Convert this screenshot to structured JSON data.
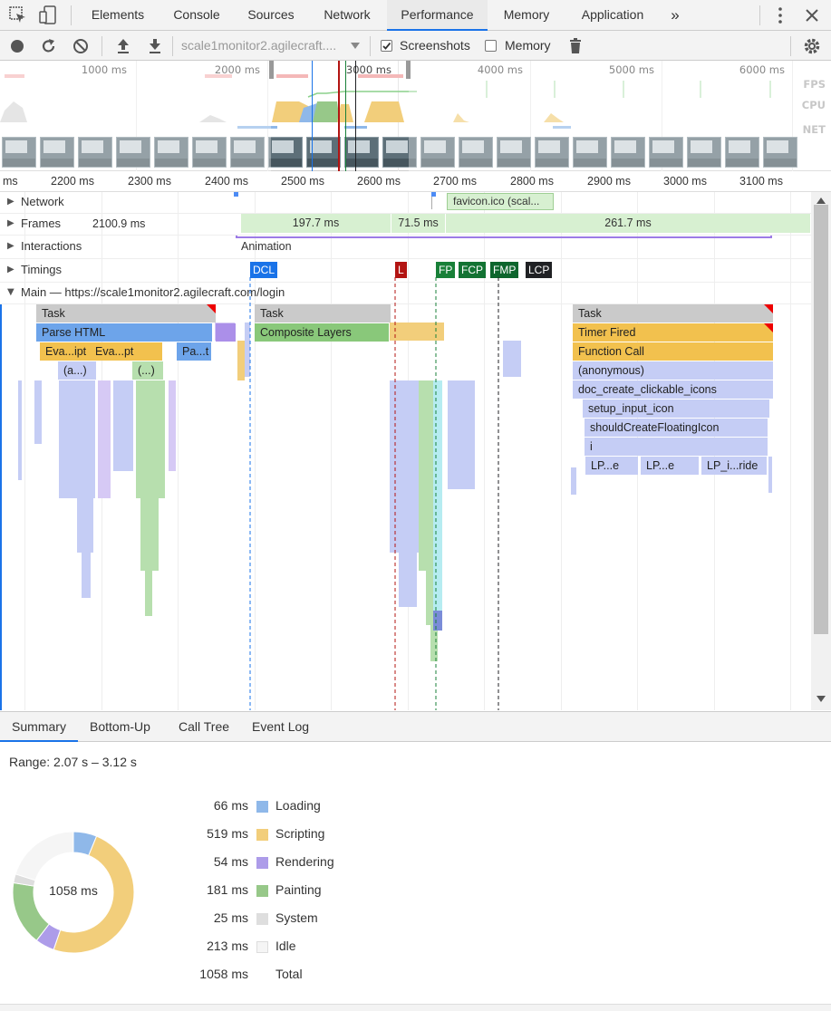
{
  "tabs": {
    "elements": "Elements",
    "console": "Console",
    "sources": "Sources",
    "network": "Network",
    "performance": "Performance",
    "memory": "Memory",
    "application": "Application",
    "more": "»"
  },
  "toolbar": {
    "profile_select": "scale1monitor2.agilecraft....",
    "screenshots_label": "Screenshots",
    "screenshots_checked": true,
    "memory_label": "Memory",
    "memory_checked": false
  },
  "overview": {
    "ticks": [
      "1000 ms",
      "2000 ms",
      "3000 ms",
      "4000 ms",
      "5000 ms",
      "6000 ms"
    ],
    "fps_label": "FPS",
    "cpu_label": "CPU",
    "net_label": "NET"
  },
  "ruler": {
    "labels": [
      "ms",
      "2200 ms",
      "2300 ms",
      "2400 ms",
      "2500 ms",
      "2600 ms",
      "2700 ms",
      "2800 ms",
      "2900 ms",
      "3000 ms",
      "3100 ms"
    ]
  },
  "tracks": {
    "network": "Network",
    "network_item": "favicon.ico (scal...",
    "frames": "Frames",
    "frame_values": [
      "2100.9 ms",
      "197.7 ms",
      "71.5 ms",
      "261.7 ms"
    ],
    "interactions": "Interactions",
    "interaction_item": "Animation",
    "timings": "Timings",
    "timing_markers": [
      "DCL",
      "L",
      "FP",
      "FCP",
      "FMP",
      "LCP"
    ],
    "main": "Main — https://scale1monitor2.agilecraft.com/login"
  },
  "flame": {
    "task": "Task",
    "parse_html": "Parse HTML",
    "eval1": "Eva...ipt",
    "eval2": "Eva...pt",
    "paint": "Pa...t",
    "anon_a": "(a...)",
    "anon_b": "(...)",
    "composite": "Composite Layers",
    "timer_fired": "Timer Fired",
    "function_call": "Function Call",
    "anonymous": "(anonymous)",
    "doc_create": "doc_create_clickable_icons",
    "setup_input": "setup_input_icon",
    "should_create": "shouldCreateFloatingIcon",
    "i": "i",
    "lp1": "LP...e",
    "lp2": "LP...e",
    "lp3": "LP_i...ride"
  },
  "bottom_tabs": {
    "summary": "Summary",
    "bottom_up": "Bottom-Up",
    "call_tree": "Call Tree",
    "event_log": "Event Log"
  },
  "summary": {
    "range": "Range: 2.07 s – 3.12 s",
    "total_center": "1058 ms",
    "rows": [
      {
        "value": "66 ms",
        "name": "Loading",
        "color": "#8fb8e9"
      },
      {
        "value": "519 ms",
        "name": "Scripting",
        "color": "#f2ce7b"
      },
      {
        "value": "54 ms",
        "name": "Rendering",
        "color": "#ad9ce9"
      },
      {
        "value": "181 ms",
        "name": "Painting",
        "color": "#97c889"
      },
      {
        "value": "25 ms",
        "name": "System",
        "color": "#dedede"
      },
      {
        "value": "213 ms",
        "name": "Idle",
        "color": "#f5f5f5"
      },
      {
        "value": "1058 ms",
        "name": "Total",
        "color": ""
      }
    ]
  }
}
